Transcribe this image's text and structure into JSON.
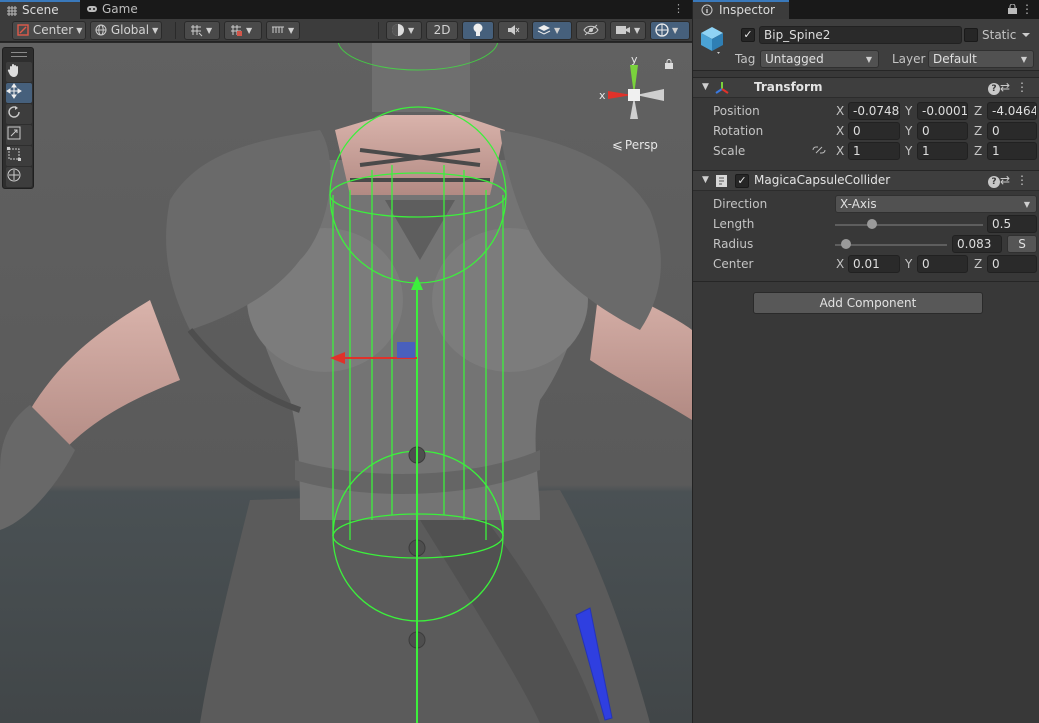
{
  "scene_tabs": {
    "scene": "Scene",
    "game": "Game"
  },
  "scene_toolbar": {
    "pivot_mode": "Center",
    "pivot_rotation": "Global",
    "mode_2d": "2D"
  },
  "viewport": {
    "projection_label": "Persp",
    "gizmo_axes": {
      "x": "x",
      "y": "y"
    }
  },
  "inspector": {
    "tab_label": "Inspector",
    "object": {
      "active": true,
      "name": "Bip_Spine2",
      "static_label": "Static",
      "static": false,
      "tag_label": "Tag",
      "tag_value": "Untagged",
      "layer_label": "Layer",
      "layer_value": "Default"
    },
    "transform": {
      "title": "Transform",
      "position_label": "Position",
      "rotation_label": "Rotation",
      "scale_label": "Scale",
      "position": {
        "x": "-0.0748",
        "y": "-0.0001",
        "z": "-4.0464"
      },
      "rotation": {
        "x": "0",
        "y": "0",
        "z": "0"
      },
      "scale": {
        "x": "1",
        "y": "1",
        "z": "1"
      }
    },
    "collider": {
      "title": "MagicaCapsuleCollider",
      "enabled": true,
      "direction_label": "Direction",
      "direction_value": "X-Axis",
      "length_label": "Length",
      "length_value": "0.5",
      "length_level": 0.25,
      "radius_label": "Radius",
      "radius_value": "0.083",
      "radius_level": 0.1,
      "s_button": "S",
      "center_label": "Center",
      "center": {
        "x": "0.01",
        "y": "0",
        "z": "0"
      }
    },
    "add_component_label": "Add Component",
    "axis_labels": {
      "x": "X",
      "y": "Y",
      "z": "Z"
    }
  },
  "colors": {
    "accent_blue": "#3a79bb",
    "collider_green": "#3cf03c",
    "gizmo_red": "#e0322a",
    "gizmo_green": "#7ad23c",
    "gizmo_blue": "#2f3fe0"
  }
}
